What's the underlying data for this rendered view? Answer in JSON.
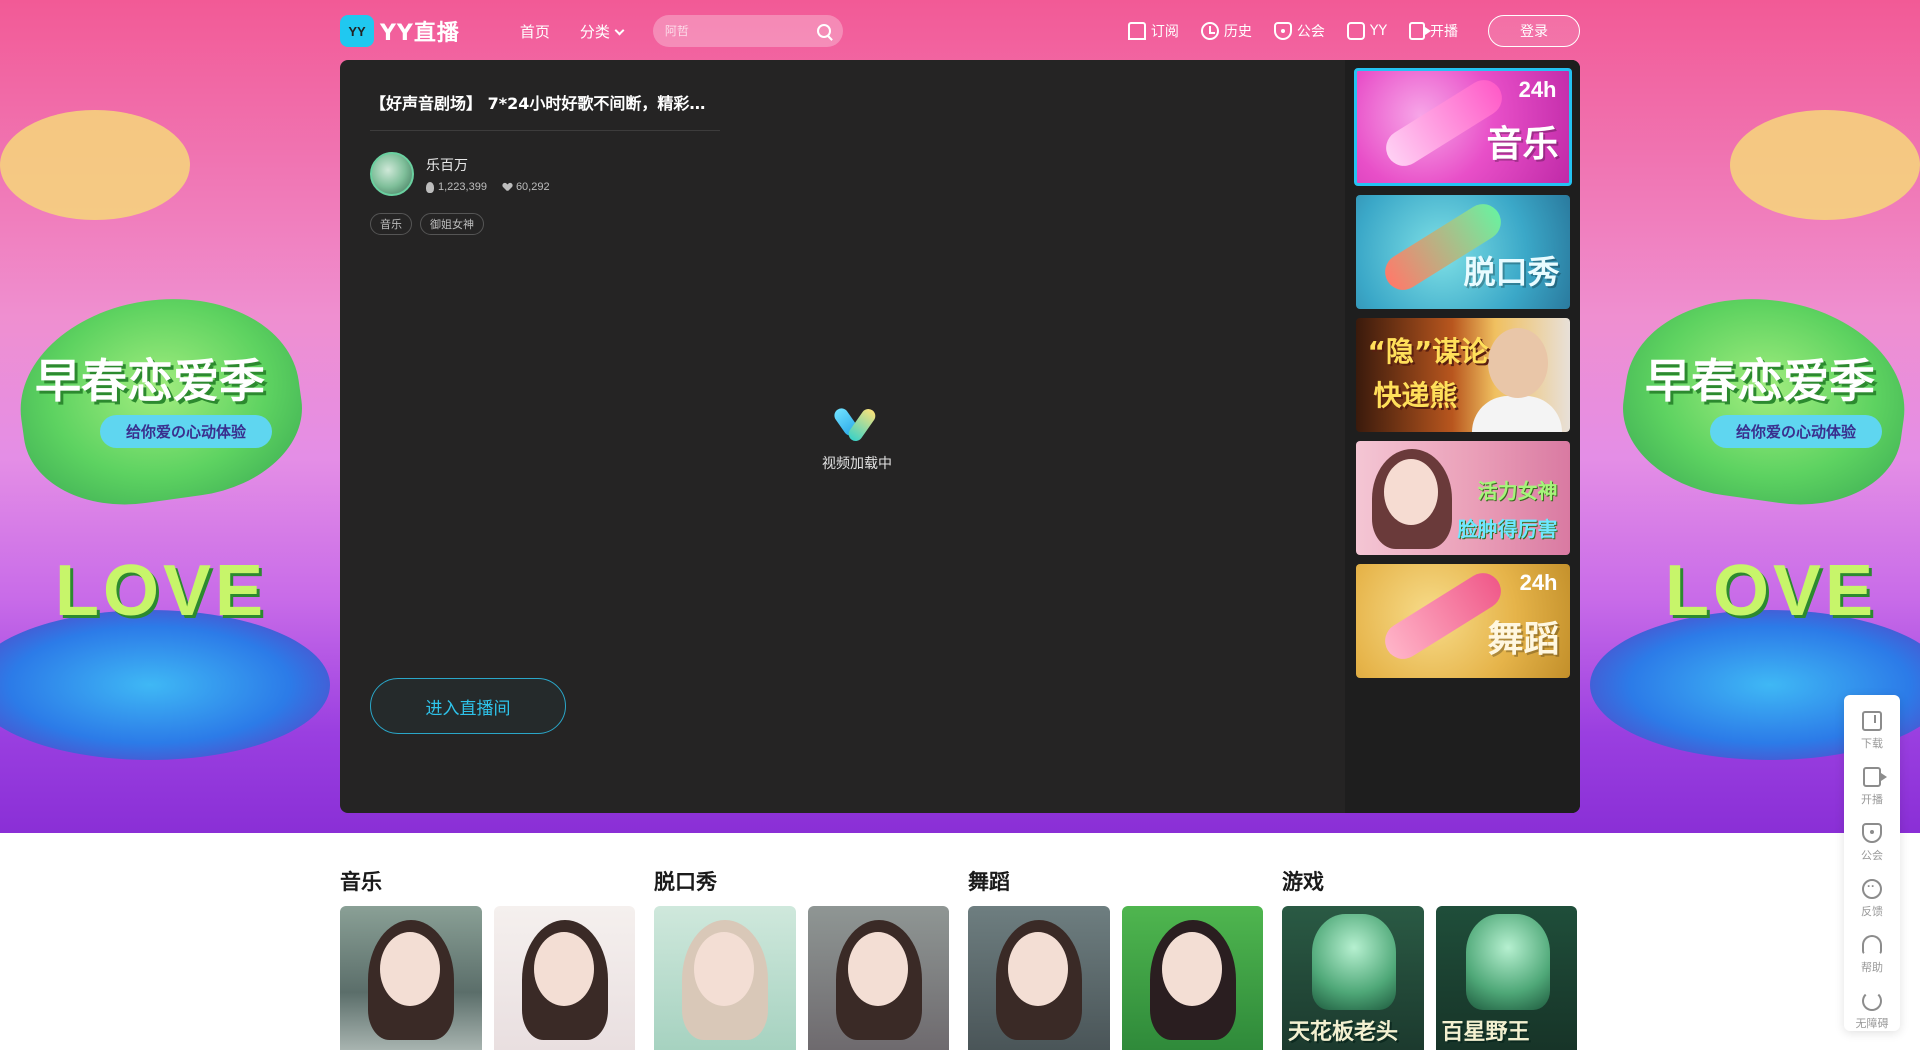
{
  "nav": {
    "logo_mark": "YY",
    "logo_text": "YY直播",
    "links": [
      "首页",
      "分类"
    ],
    "search_placeholder": "阿哲",
    "items": [
      "订阅",
      "历史",
      "公会",
      "YY",
      "开播"
    ],
    "login": "登录"
  },
  "hero": {
    "banner_text": "早春恋爱季",
    "ribbon_text": "给你爱の心动体验",
    "love_text": "LOVE"
  },
  "player": {
    "title": "【好声音剧场】 7*24小时好歌不间断，精彩不...",
    "anchor_name": "乐百万",
    "heat": "1,223,399",
    "likes": "60,292",
    "tags": [
      "音乐",
      "御姐女神"
    ],
    "loading_text": "视频加载中",
    "enter_button": "进入直播间",
    "side_thumbs": [
      {
        "label": "音乐",
        "badge": "24h"
      },
      {
        "label": "脱口秀"
      },
      {
        "line1": "“隐”谋论",
        "line2": "快递熊"
      },
      {
        "line1": "活力女神",
        "line2": "脸肿得厉害"
      },
      {
        "label": "舞蹈",
        "badge": "24h"
      }
    ]
  },
  "categories": [
    {
      "title": "音乐",
      "cards": 2
    },
    {
      "title": "脱口秀",
      "cards": 2
    },
    {
      "title": "舞蹈",
      "cards": 2
    },
    {
      "title": "游戏",
      "card_texts": [
        "天花板老头",
        "百星野王"
      ]
    }
  ],
  "toolbar": [
    "下载",
    "开播",
    "公会",
    "反馈",
    "帮助",
    "无障碍"
  ],
  "colors": {
    "accent": "#24c3f3",
    "player_bg": "#252424",
    "side_bg": "#1e1e1e"
  }
}
